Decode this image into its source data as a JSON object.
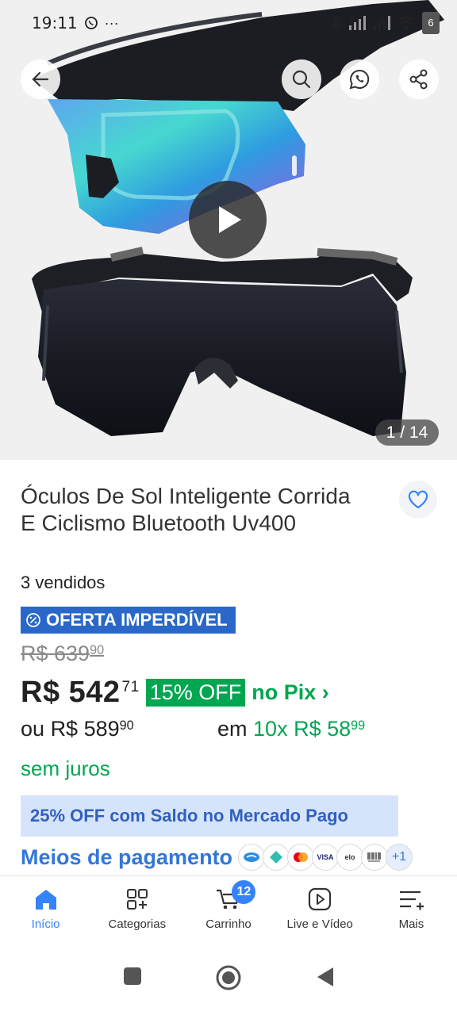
{
  "status_bar": {
    "time": "19:11",
    "battery": "6"
  },
  "gallery": {
    "counter": "1 / 14",
    "icons": [
      "arrow-left-icon",
      "search-icon",
      "whatsapp-icon",
      "share-icon",
      "play-icon"
    ]
  },
  "product": {
    "title": "Óculos De Sol Inteligente Corrida E Ciclismo Bluetooth Uv400",
    "sold": "3 vendidos",
    "offer_badge": "OFERTA IMPERDÍVEL",
    "old_price_int": "R$ 639",
    "old_price_cents": "90",
    "price_int": "R$ 542",
    "price_cents": "71",
    "discount": "15% OFF",
    "pix_label": "no Pix",
    "installment_prefix": "ou",
    "installment_total_int": "R$ 589",
    "installment_total_cents": "90",
    "installment_in": "em",
    "installment_count": "10x",
    "installment_value_int": "R$ 58",
    "installment_value_cents": "99",
    "no_interest": "sem juros"
  },
  "saldo_banner": "25% OFF com Saldo no Mercado Pago",
  "payments": {
    "label": "Meios de pagamento",
    "methods": [
      "Mercado Pago",
      "Pix",
      "Mastercard",
      "VISA",
      "elo",
      "Boleto"
    ],
    "more": "+1"
  },
  "bottom_nav": {
    "items": [
      {
        "label": "Início",
        "icon": "home-icon"
      },
      {
        "label": "Categorias",
        "icon": "categories-icon"
      },
      {
        "label": "Carrinho",
        "icon": "cart-icon"
      },
      {
        "label": "Live e Vídeo",
        "icon": "play-square-icon"
      },
      {
        "label": "Mais",
        "icon": "menu-plus-icon"
      }
    ],
    "cart_count": "12"
  },
  "colors": {
    "accent_blue": "#3483fa",
    "green": "#00a650",
    "offer_badge": "#2968c8",
    "banner_bg": "#d6e4fb"
  }
}
